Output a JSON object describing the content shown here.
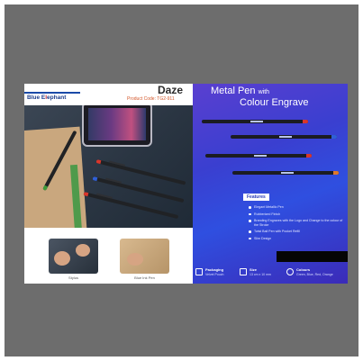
{
  "left_panel": {
    "brand": {
      "part1": "Blue E",
      "part2": "l",
      "part3": "ephant"
    },
    "product_name": "Daze",
    "product_code": "Product Code: TG2-911",
    "thumbnails": [
      {
        "label": "Stylus"
      },
      {
        "label": "Blue Ink Pen"
      }
    ]
  },
  "right_panel": {
    "title_main": "Metal Pen",
    "title_small": "with",
    "title_line2": "Colour Engrave",
    "features_heading": "Features",
    "features": [
      "Elegant Metallic Pen",
      "Rubberized Finish",
      "Branding Engraves with the Logo and Change to the colour of the Stroke",
      "Twist Ball Pen with Pocket Refill",
      "Slim Design"
    ],
    "bottom_info": [
      {
        "icon": "box-icon",
        "title": "Packaging",
        "value": "Velvet Pouch"
      },
      {
        "icon": "ruler-icon",
        "title": "Size",
        "value": "13 cm x 10 mm"
      },
      {
        "icon": "palette-icon",
        "title": "Colours",
        "value": "Green, Blue, Red, Orange"
      }
    ]
  },
  "colors": {
    "background_frame": "#6d6d6d",
    "accent_blue": "#2f4fe0",
    "brand_red": "#c8202a",
    "pen_tip_colors": [
      "#d9362b",
      "#2f5fd6",
      "#d9362b",
      "#e0772a"
    ]
  }
}
